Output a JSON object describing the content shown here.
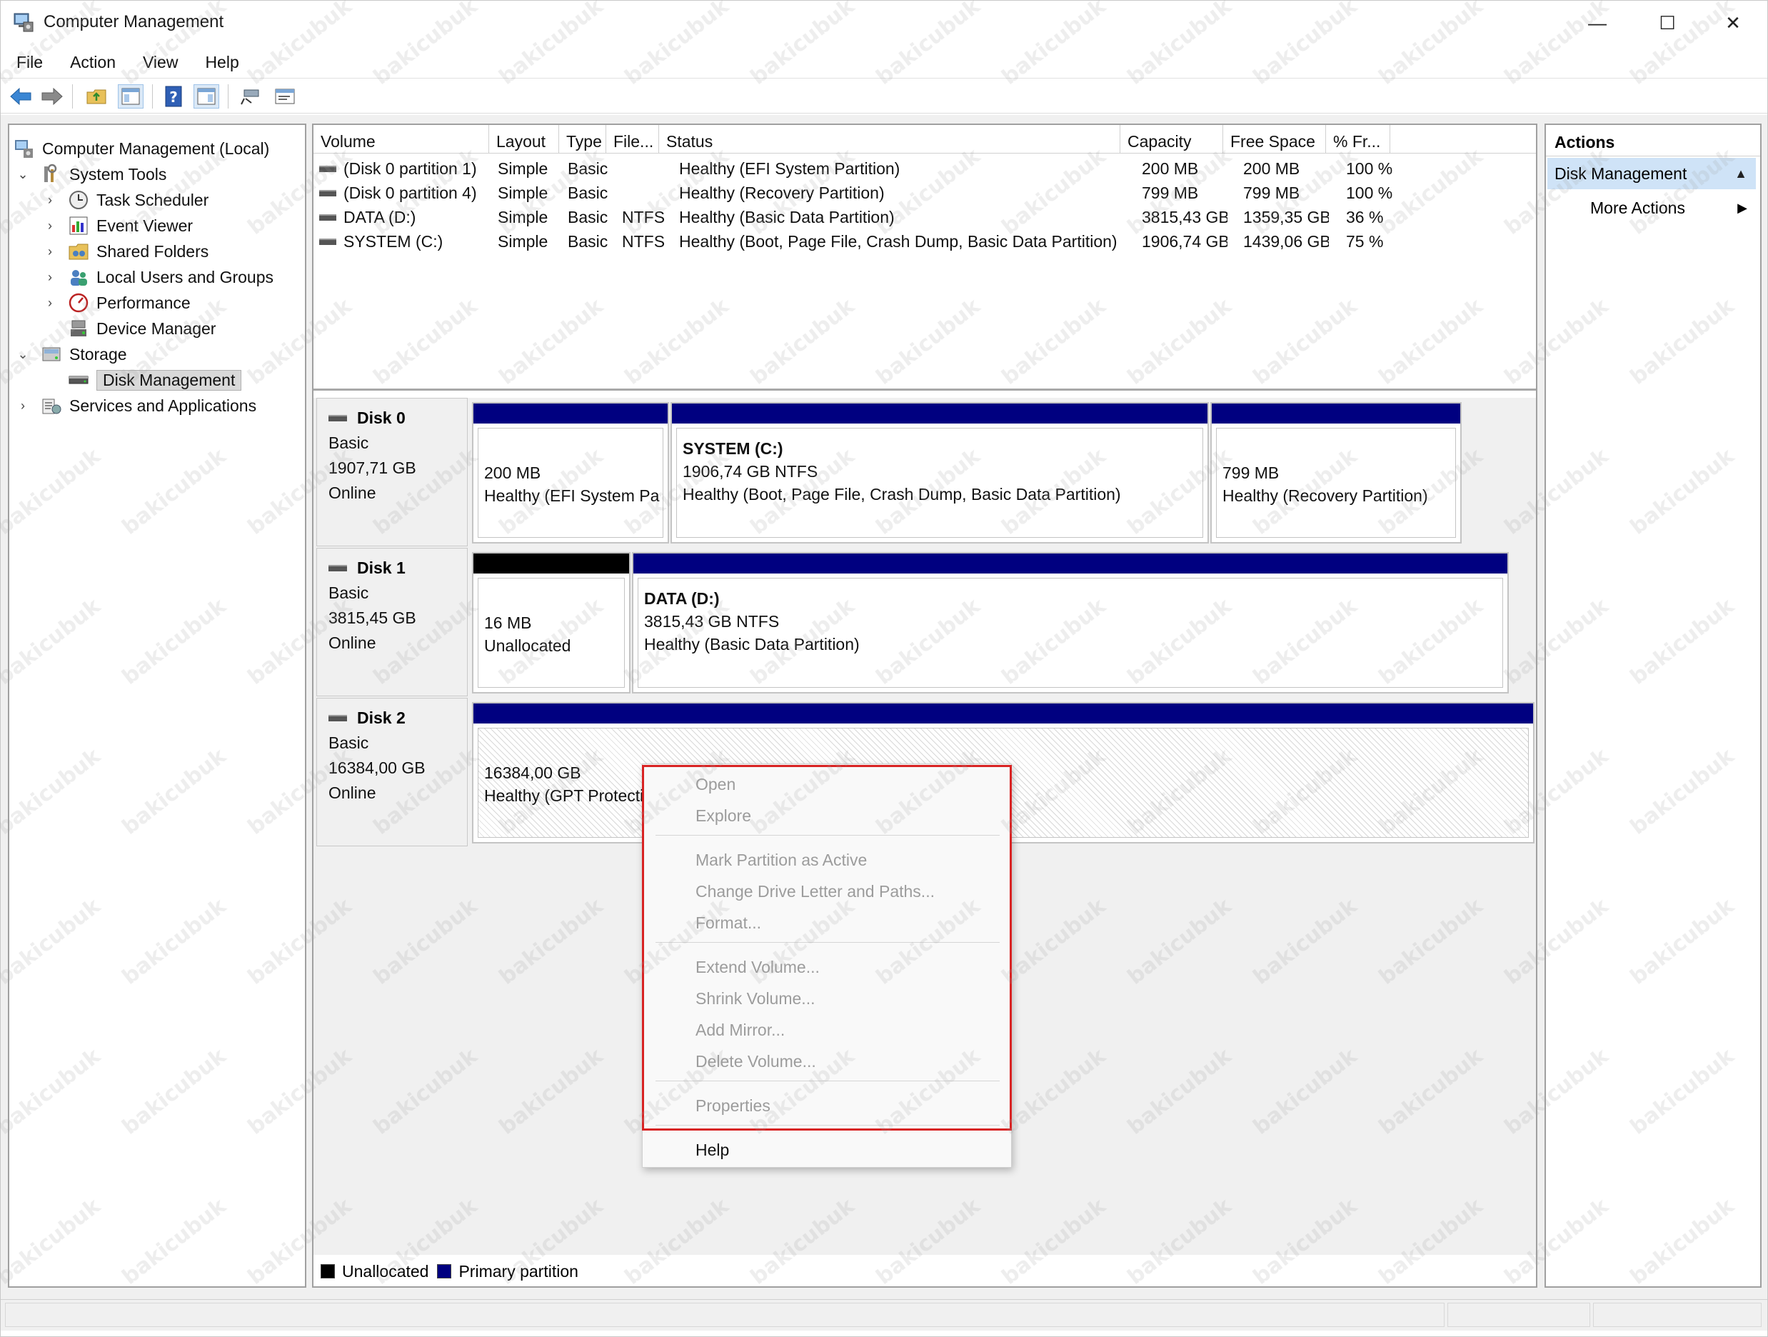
{
  "window": {
    "title": "Computer Management",
    "controls": {
      "minimize": "—",
      "maximize": "☐",
      "close": "✕"
    }
  },
  "menubar": [
    "File",
    "Action",
    "View",
    "Help"
  ],
  "toolbar": {
    "icons": [
      "back-arrow-icon",
      "forward-arrow-icon",
      "folder-up-icon",
      "show-hide-console-tree-icon",
      "help-icon",
      "show-hide-action-pane-icon",
      "connect-icon",
      "properties-icon"
    ]
  },
  "tree": {
    "root": "Computer Management (Local)",
    "system_tools": "System Tools",
    "task_scheduler": "Task Scheduler",
    "event_viewer": "Event Viewer",
    "shared_folders": "Shared Folders",
    "local_users": "Local Users and Groups",
    "performance": "Performance",
    "device_manager": "Device Manager",
    "storage": "Storage",
    "disk_management": "Disk Management",
    "services": "Services and Applications"
  },
  "volume_list": {
    "headers": [
      "Volume",
      "Layout",
      "Type",
      "File...",
      "Status",
      "Capacity",
      "Free Space",
      "% Fr..."
    ],
    "rows": [
      [
        "(Disk 0 partition 1)",
        "Simple",
        "Basic",
        "",
        "Healthy (EFI System Partition)",
        "200 MB",
        "200 MB",
        "100 %"
      ],
      [
        "(Disk 0 partition 4)",
        "Simple",
        "Basic",
        "",
        "Healthy (Recovery Partition)",
        "799 MB",
        "799 MB",
        "100 %"
      ],
      [
        "DATA (D:)",
        "Simple",
        "Basic",
        "NTFS",
        "Healthy (Basic Data Partition)",
        "3815,43 GB",
        "1359,35 GB",
        "36 %"
      ],
      [
        "SYSTEM (C:)",
        "Simple",
        "Basic",
        "NTFS",
        "Healthy (Boot, Page File, Crash Dump, Basic Data Partition)",
        "1906,74 GB",
        "1439,06 GB",
        "75 %"
      ]
    ]
  },
  "disks": {
    "disk0": {
      "name": "Disk 0",
      "type": "Basic",
      "size": "1907,71 GB",
      "state": "Online",
      "p1": {
        "size": "200 MB",
        "status": "Healthy (EFI System Pa"
      },
      "p2": {
        "name": "SYSTEM  (C:)",
        "size": "1906,74 GB NTFS",
        "status": "Healthy (Boot, Page File, Crash Dump, Basic Data Partition)"
      },
      "p3": {
        "size": "799 MB",
        "status": "Healthy (Recovery Partition)"
      }
    },
    "disk1": {
      "name": "Disk 1",
      "type": "Basic",
      "size": "3815,45 GB",
      "state": "Online",
      "p1": {
        "size": "16 MB",
        "status": "Unallocated"
      },
      "p2": {
        "name": "DATA  (D:)",
        "size": "3815,43 GB NTFS",
        "status": "Healthy (Basic Data Partition)"
      }
    },
    "disk2": {
      "name": "Disk 2",
      "type": "Basic",
      "size": "16384,00 GB",
      "state": "Online",
      "p1": {
        "size": "16384,00 GB",
        "status": "Healthy (GPT Protecti"
      }
    }
  },
  "legend": {
    "unallocated": "Unallocated",
    "primary": "Primary partition",
    "unallocated_color": "#000000",
    "primary_color": "#000080"
  },
  "actions": {
    "header": "Actions",
    "selected": "Disk Management",
    "more": "More Actions"
  },
  "context_menu": {
    "open": "Open",
    "explore": "Explore",
    "mark_active": "Mark Partition as Active",
    "change_letter": "Change Drive Letter and Paths...",
    "format": "Format...",
    "extend": "Extend Volume...",
    "shrink": "Shrink Volume...",
    "add_mirror": "Add Mirror...",
    "delete": "Delete Volume...",
    "properties": "Properties",
    "help": "Help"
  },
  "watermark": "bakicubuk",
  "colors": {
    "primary_bar": "#000080",
    "selection": "#cfe3f7",
    "highlight_border": "#d82323"
  }
}
